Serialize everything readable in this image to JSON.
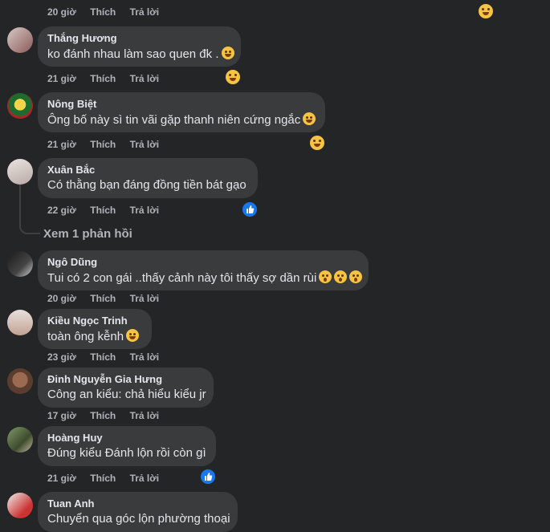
{
  "top_meta": {
    "time": "20 giờ",
    "like": "Thích",
    "reply": "Trả lời"
  },
  "comments": [
    {
      "author": "Thắng Hương",
      "text": "ko đánh nhau làm sao quen đk .",
      "time": "21 giờ",
      "like": "Thích",
      "reply": "Trả lời",
      "trailing_emoji": "rofl-emoji",
      "reaction": "haha-reaction-icon"
    },
    {
      "author": "Nông Biệt",
      "text": "Ông bố này sì tin vãi gặp thanh niên cứng ngắc",
      "time": "21 giờ",
      "like": "Thích",
      "reply": "Trả lời",
      "trailing_emoji": "rofl-emoji",
      "reaction": "haha-reaction-icon"
    },
    {
      "author": "Xuân Bắc",
      "text": "Có thằng bạn đáng đồng tiền bát gạo",
      "time": "22 giờ",
      "like": "Thích",
      "reply": "Trả lời",
      "reaction": "like-reaction-icon"
    },
    {
      "author": "Ngô Dũng",
      "text": "Tui có 2 con gái ..thấy cảnh này tôi thấy sợ dần rùi",
      "time": "20 giờ",
      "like": "Thích",
      "reply": "Trả lời",
      "trailing_emoji": "scream-emoji-x3"
    },
    {
      "author": "Kiều Ngọc Trinh",
      "text": "toàn ông kễnh",
      "time": "23 giờ",
      "like": "Thích",
      "reply": "Trả lời",
      "trailing_emoji": "laugh-tears-emoji"
    },
    {
      "author": "Đinh Nguyễn Gia Hưng",
      "text": "Công an kiểu: chả hiểu kiểu jr",
      "time": "17 giờ",
      "like": "Thích",
      "reply": "Trả lời"
    },
    {
      "author": "Hoàng Huy",
      "text": "Đúng kiểu Đánh lộn rồi còn gì",
      "time": "21 giờ",
      "like": "Thích",
      "reply": "Trả lời",
      "reaction": "like-reaction-icon"
    },
    {
      "author": "Tuan Anh",
      "text": "Chuyển qua góc lộn phường thoại"
    }
  ],
  "view_replies": "Xem 1 phản hồi",
  "colors": {
    "background": "#242526",
    "bubble": "#3a3b3c",
    "secondary_text": "#b0b3b8",
    "like_blue": "#1877f2",
    "haha_yellow": "#f7c442"
  }
}
